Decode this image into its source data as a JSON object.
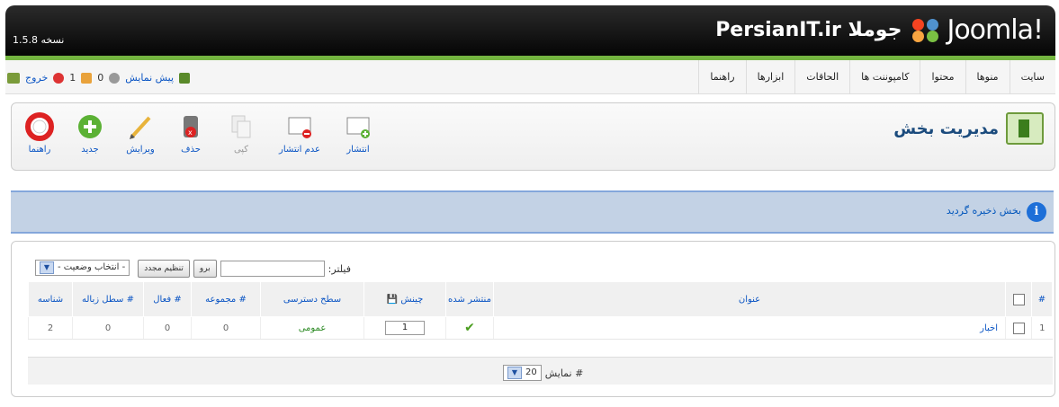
{
  "header": {
    "version": "نسخه 1.5.8",
    "site_name": "PersianIT.ir جوملا",
    "logo_word": "Joomla!",
    "logo_colors": [
      "#f44321",
      "#5091cd",
      "#f9a541",
      "#7ac143"
    ]
  },
  "menu": {
    "items": [
      "سایت",
      "منوها",
      "محتوا",
      "کامپوننت ها",
      "الحاقات",
      "ابزارها",
      "راهنما"
    ]
  },
  "status": {
    "logout": "خروج",
    "messages": "1",
    "users": "0",
    "preview": "پیش نمایش"
  },
  "toolbar": {
    "title": "مدیریت بخش",
    "tools": [
      {
        "label": "راهنما",
        "icon": "help-icon"
      },
      {
        "label": "جدید",
        "icon": "new-icon"
      },
      {
        "label": "ویرایش",
        "icon": "edit-icon"
      },
      {
        "label": "حذف",
        "icon": "delete-icon"
      },
      {
        "label": "کپی",
        "icon": "copy-icon"
      },
      {
        "label": "عدم انتشار",
        "icon": "unpublish-icon"
      },
      {
        "label": "انتشار",
        "icon": "publish-icon"
      }
    ]
  },
  "message": {
    "text": "بخش ذخیره گردید",
    "icon": "info-icon"
  },
  "filter": {
    "label": "فیلتر:",
    "value": "",
    "go_button": "برو",
    "reset_button": "تنظیم مجدد",
    "status_select": "- انتخاب وضعیت -"
  },
  "table": {
    "headers": {
      "num": "#",
      "title": "عنوان",
      "published": "منتشر شده",
      "order": "چینش",
      "access": "سطح دسترسی",
      "categories": "# مجموعه",
      "active": "# فعال",
      "trash": "# سطل زباله",
      "id": "شناسه"
    },
    "rows": [
      {
        "num": "1",
        "title": "اخبار",
        "published": "✔",
        "order": "1",
        "access": "عمومی",
        "categories": "0",
        "active": "0",
        "trash": "0",
        "id": "2"
      }
    ]
  },
  "footer": {
    "display_label": "نمایش #",
    "limit": "20"
  }
}
